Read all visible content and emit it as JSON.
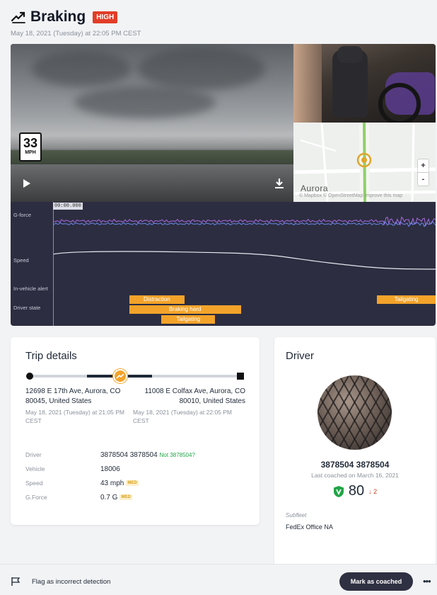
{
  "header": {
    "title": "Braking",
    "severity": "HIGH",
    "subtitle": "May 18, 2021 (Tuesday) at 22:05 PM CEST"
  },
  "video": {
    "speed_value": "33",
    "speed_unit": "MPH"
  },
  "map": {
    "city": "Aurora",
    "attribution": "© Mapbox © OpenStreetMap Improve this map",
    "zoom_in": "+",
    "zoom_out": "-"
  },
  "timeline": {
    "time": "00:00.000",
    "rows": [
      "G-force",
      "Speed",
      "In-vehicle alert",
      "Driver state"
    ],
    "states": [
      {
        "label": "Distraction",
        "start": 0.199,
        "end": 0.344,
        "row": 0
      },
      {
        "label": "Braking hard",
        "start": 0.199,
        "end": 0.491,
        "row": 1
      },
      {
        "label": "Tailgating",
        "start": 0.283,
        "end": 0.424,
        "row": 2
      },
      {
        "label": "Tailgating",
        "start": 0.847,
        "end": 1.0,
        "row": 0
      }
    ],
    "colors": {
      "gforce_purple": "#a86ae0",
      "gforce_blue": "#6a88e8",
      "speed": "#e8e8f0",
      "state": "#f3a32a"
    }
  },
  "trip": {
    "title": "Trip details",
    "start_address_line1": "12698 E 17th Ave, Aurora, CO",
    "start_address_line2": "80045, United States",
    "start_time_line1": "May 18, 2021 (Tuesday) at 21:05 PM",
    "start_time_line2": "CEST",
    "end_address_line1": "11008 E Colfax Ave, Aurora, CO",
    "end_address_line2": "80010, United States",
    "end_time_line1": "May 18, 2021 (Tuesday) at 22:05 PM",
    "end_time_line2": "CEST",
    "details": {
      "driver_label": "Driver",
      "driver_value": "3878504 3878504",
      "driver_link": "Not 3878504?",
      "vehicle_label": "Vehicle",
      "vehicle_value": "18006",
      "speed_label": "Speed",
      "speed_value": "43 mph",
      "speed_badge": "MED",
      "gforce_label": "G.Force",
      "gforce_value": "0.7 G",
      "gforce_badge": "MED"
    }
  },
  "driver": {
    "title": "Driver",
    "name": "3878504 3878504",
    "last_coached": "Last coached on March 16, 2021",
    "score": "80",
    "score_delta": "↓ 2",
    "subfleet_label": "Subfleet",
    "subfleet_value": "FedEx Office NA"
  },
  "footer": {
    "flag_text": "Flag as incorrect detection",
    "coach_button": "Mark as coached",
    "more": "•••"
  },
  "colors": {
    "accent_dark": "#2f3041",
    "severity_red": "#e23d28",
    "event_orange": "#f3a32a",
    "shield_green": "#22a447"
  }
}
